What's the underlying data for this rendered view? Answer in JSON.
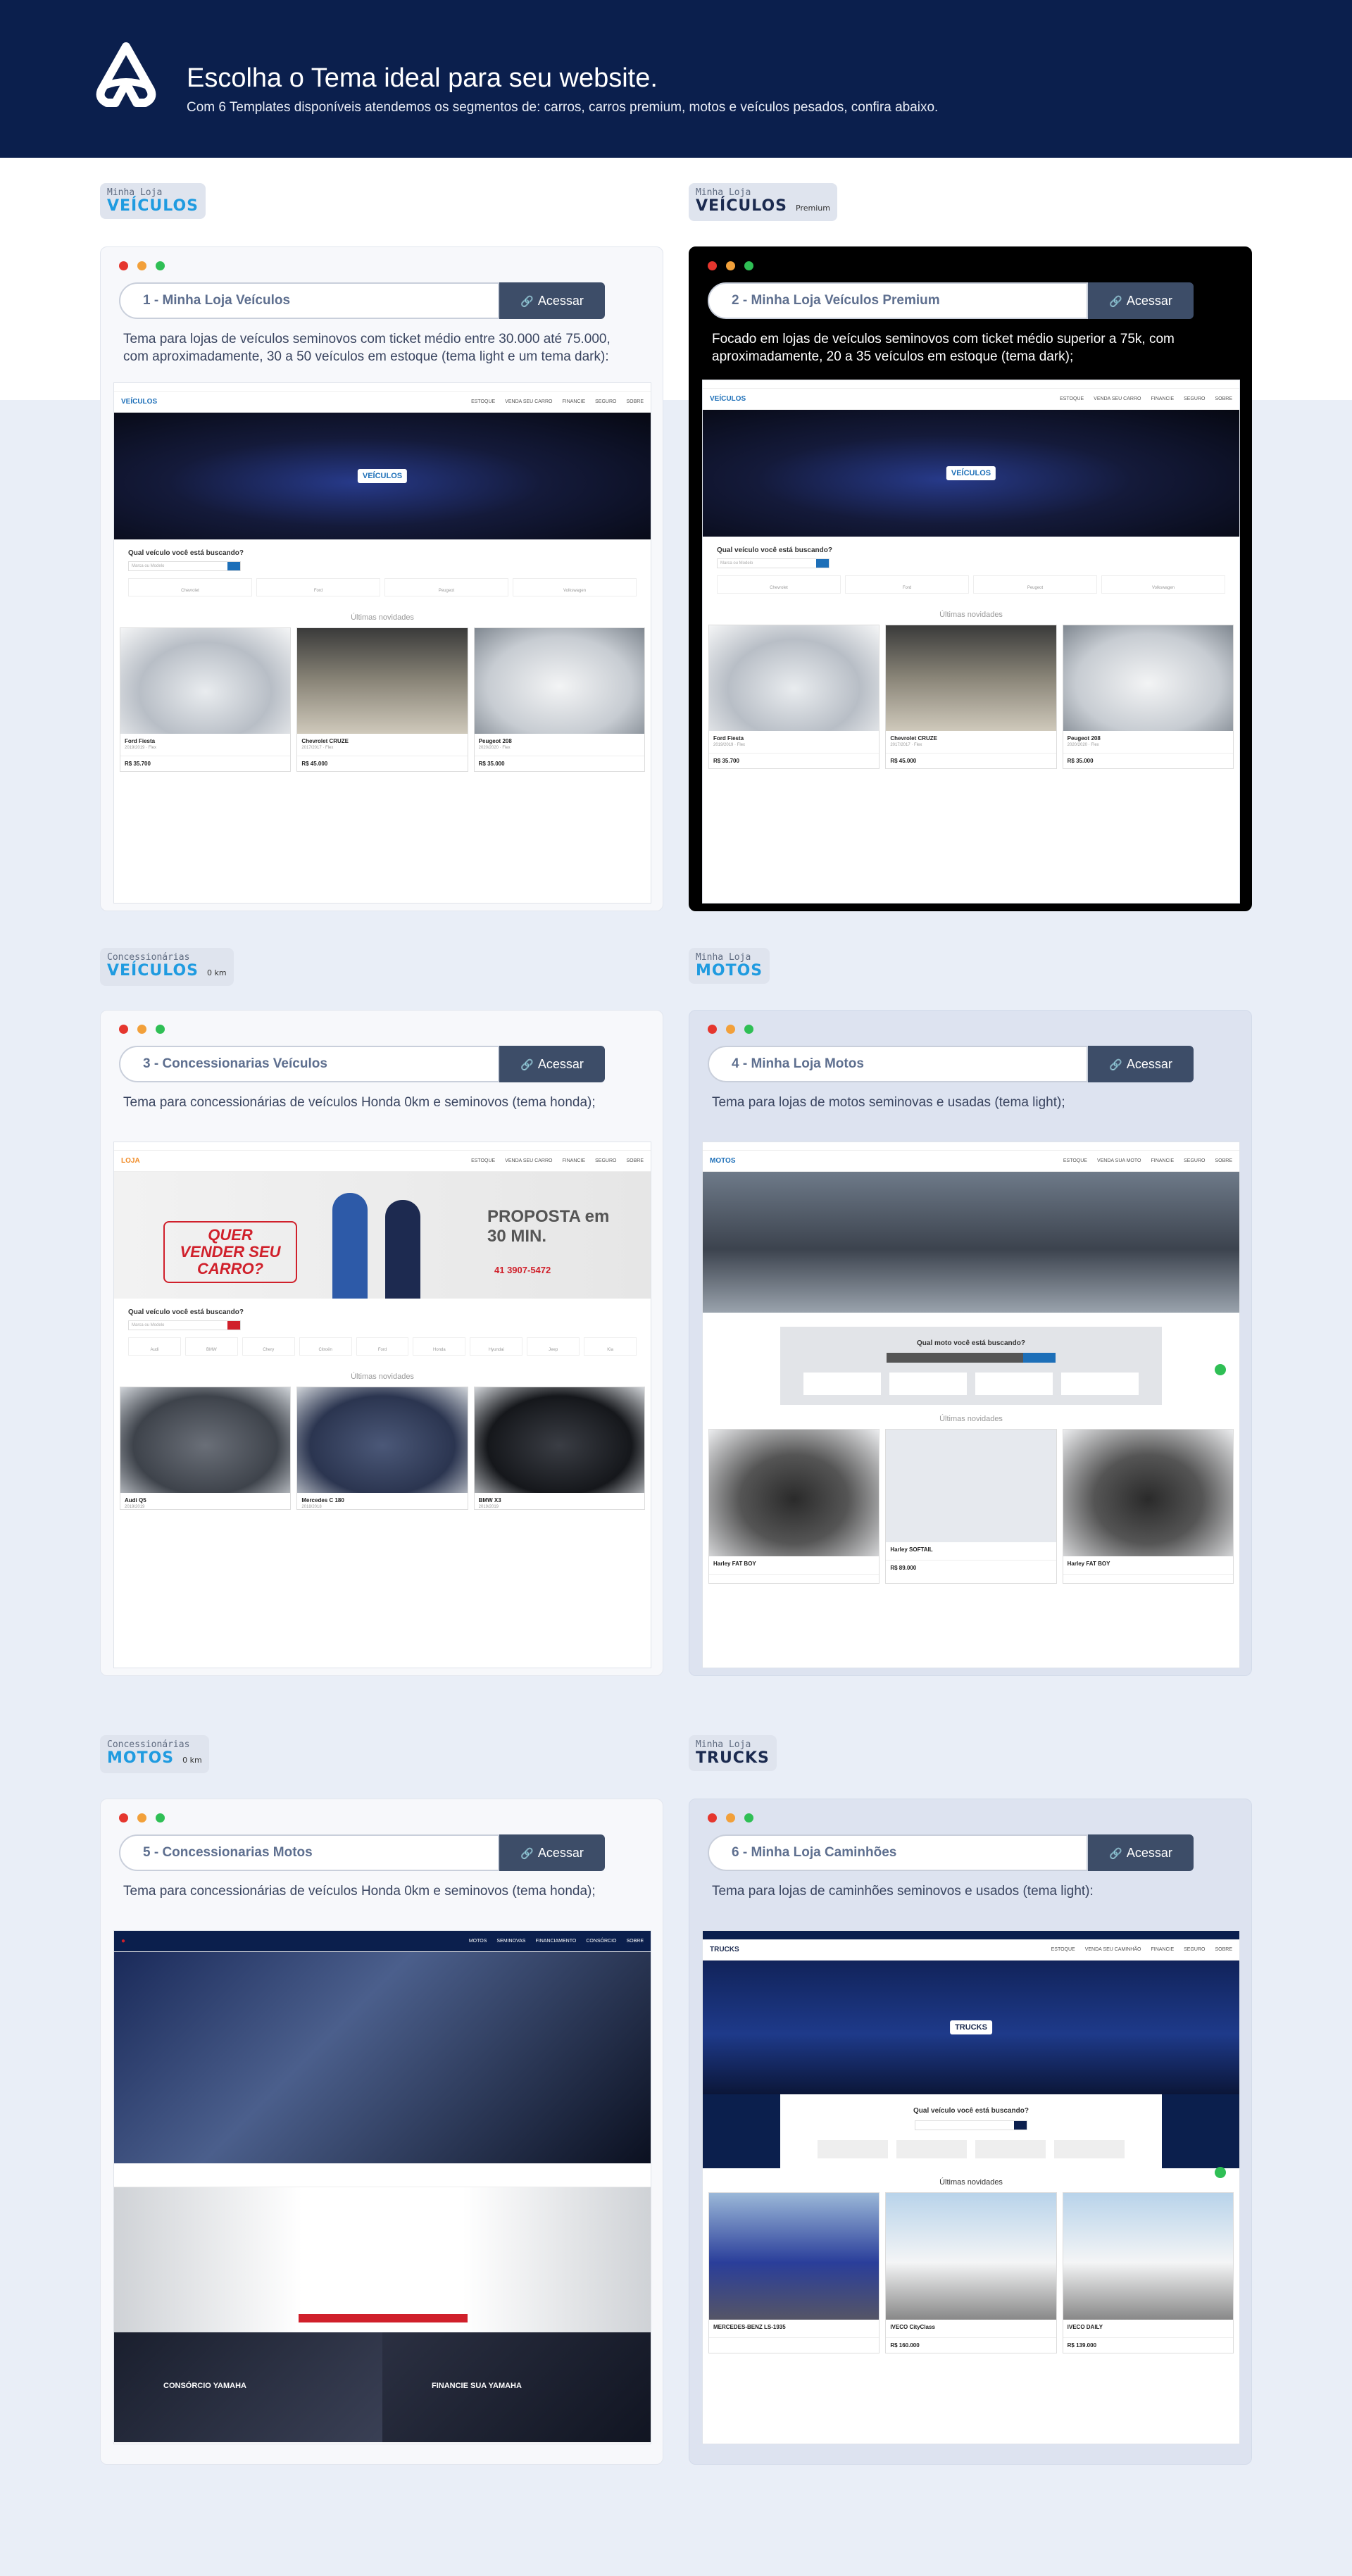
{
  "header": {
    "title": "Escolha o Tema ideal para seu website.",
    "subtitle": "Com 6 Templates disponíveis atendemos os segmentos de: carros, carros premium, motos e veículos pesados, confira abaixo."
  },
  "colors": {
    "header_bg": "#0b1f4d",
    "accent_blue": "#1f9be0",
    "button": "#3d4d68"
  },
  "access_label": "Acessar",
  "templates": [
    {
      "tag_small": "Minha Loja",
      "tag_big": "VEÍCULOS",
      "tag_extra": "",
      "name": "1 - Minha Loja Veículos",
      "description": "Tema para lojas de veículos seminovos com ticket médio entre 30.000 até 75.000, com aproximadamente, 30 a 50 veículos em estoque (tema light e um tema dark):",
      "preview": {
        "logo": "VEÍCULOS",
        "hero_badge": "VEÍCULOS",
        "search_q": "Qual veículo você está buscando?",
        "section": "Últimas novidades",
        "cars": [
          {
            "name": "Ford Fiesta",
            "price": "R$ 35.700"
          },
          {
            "name": "Chevrolet CRUZE",
            "price": "R$ 45.000"
          },
          {
            "name": "Peugeot 208",
            "price": "R$ 35.000"
          }
        ]
      }
    },
    {
      "tag_small": "Minha Loja",
      "tag_big": "VEÍCULOS",
      "tag_extra": "Premium",
      "name": "2 - Minha Loja Veículos Premium",
      "description": "Focado em lojas de veículos seminovos com ticket médio superior a 75k, com aproximadamente, 20 a 35 veículos em estoque (tema dark);",
      "preview": {
        "logo": "VEÍCULOS",
        "hero_badge": "VEÍCULOS",
        "search_q": "Qual veículo você está buscando?",
        "section": "Últimas novidades",
        "cars": [
          {
            "name": "Ford Fiesta",
            "price": "R$ 35.700"
          },
          {
            "name": "Chevrolet CRUZE",
            "price": "R$ 45.000"
          },
          {
            "name": "Peugeot 208",
            "price": "R$ 35.000"
          }
        ]
      }
    },
    {
      "tag_small": "Concessionárias",
      "tag_big": "VEÍCULOS",
      "tag_extra": "0 km",
      "name": "3 - Concessionarias  Veículos",
      "description": "Tema para concessionárias de veículos Honda 0km e seminovos (tema honda);",
      "preview": {
        "logo": "LOJA",
        "banner_left": "QUER VENDER SEU CARRO?",
        "banner_right": "PROPOSTA em 30 MIN.",
        "banner_phone": "41 3907-5472",
        "search_q": "Qual veículo você está buscando?",
        "section": "Últimas novidades",
        "cars": [
          {
            "name": "Audi Q5",
            "price": ""
          },
          {
            "name": "Mercedes C 180",
            "price": ""
          },
          {
            "name": "BMW X3",
            "price": ""
          }
        ]
      }
    },
    {
      "tag_small": "Minha Loja",
      "tag_big": "MOTOS",
      "tag_extra": "",
      "name": "4 - Minha Loja Motos",
      "description": "Tema para lojas de motos seminovas e usadas (tema light);",
      "preview": {
        "logo": "MOTOS",
        "search_q": "Qual moto você está buscando?",
        "section": "Últimas novidades",
        "cars": [
          {
            "name": "Harley FAT BOY",
            "price": ""
          },
          {
            "name": "Harley SOFTAIL",
            "price": "R$ 89.000"
          },
          {
            "name": "Harley FAT BOY",
            "price": ""
          }
        ]
      }
    },
    {
      "tag_small": "Concessionárias",
      "tag_big": "MOTOS",
      "tag_extra": "0 km",
      "name": "5 - Concessionarias Motos",
      "description": "Tema para concessionárias de veículos Honda 0km e seminovos (tema honda);",
      "preview": {
        "promo_left": "CONSÓRCIO YAMAHA",
        "promo_right": "FINANCIE SUA YAMAHA"
      }
    },
    {
      "tag_small": "Minha Loja",
      "tag_big": "TRUCKS",
      "tag_extra": "",
      "name": "6 - Minha Loja Caminhões",
      "description": "Tema para lojas de caminhões seminovos e usados (tema light):",
      "preview": {
        "logo": "TRUCKS",
        "hero_badge": "TRUCKS",
        "search_q": "Qual veículo você está buscando?",
        "section": "Últimas novidades",
        "cars": [
          {
            "name": "MERCEDES-BENZ LS-1935",
            "price": ""
          },
          {
            "name": "IVECO CityClass",
            "price": "R$ 160.000"
          },
          {
            "name": "IVECO DAILY",
            "price": "R$ 139.000"
          }
        ]
      }
    }
  ]
}
